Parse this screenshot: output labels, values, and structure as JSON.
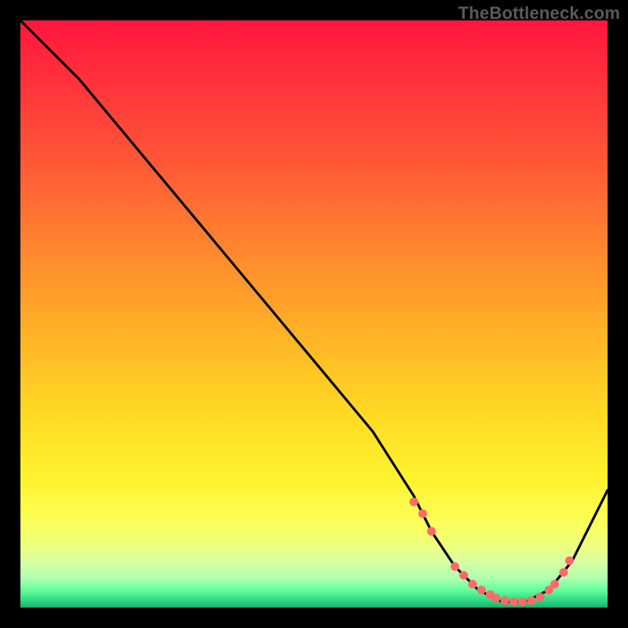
{
  "attribution": "TheBottleneck.com",
  "chart_data": {
    "type": "line",
    "title": "",
    "xlabel": "",
    "ylabel": "",
    "xlim": [
      0,
      100
    ],
    "ylim": [
      0,
      100
    ],
    "series": [
      {
        "name": "bottleneck-curve",
        "x": [
          0,
          4,
          10,
          20,
          30,
          40,
          50,
          60,
          67,
          70,
          74,
          78,
          82,
          86,
          90,
          94,
          100
        ],
        "y": [
          100,
          96,
          90,
          78,
          66,
          54,
          42,
          30,
          19,
          13,
          7,
          3,
          1,
          1,
          3,
          8,
          20
        ]
      }
    ],
    "markers": {
      "name": "highlight-dots",
      "color": "#ff6a6a",
      "points_x": [
        67,
        68.5,
        70,
        74,
        75.5,
        77,
        78.5,
        80,
        81,
        82.5,
        84,
        85.5,
        87,
        88.5,
        90,
        91,
        92.5,
        93.5
      ],
      "points_y": [
        18,
        16,
        13,
        7,
        5.5,
        4,
        3,
        2.2,
        1.6,
        1.2,
        1,
        1,
        1.2,
        1.8,
        3,
        4,
        6,
        8
      ]
    },
    "gradient_stops": [
      {
        "pos": 0,
        "color": "#ff163e"
      },
      {
        "pos": 25,
        "color": "#ff5a36"
      },
      {
        "pos": 55,
        "color": "#ffb726"
      },
      {
        "pos": 78,
        "color": "#fff22e"
      },
      {
        "pos": 92,
        "color": "#d9ffa0"
      },
      {
        "pos": 100,
        "color": "#1fab6a"
      }
    ]
  }
}
